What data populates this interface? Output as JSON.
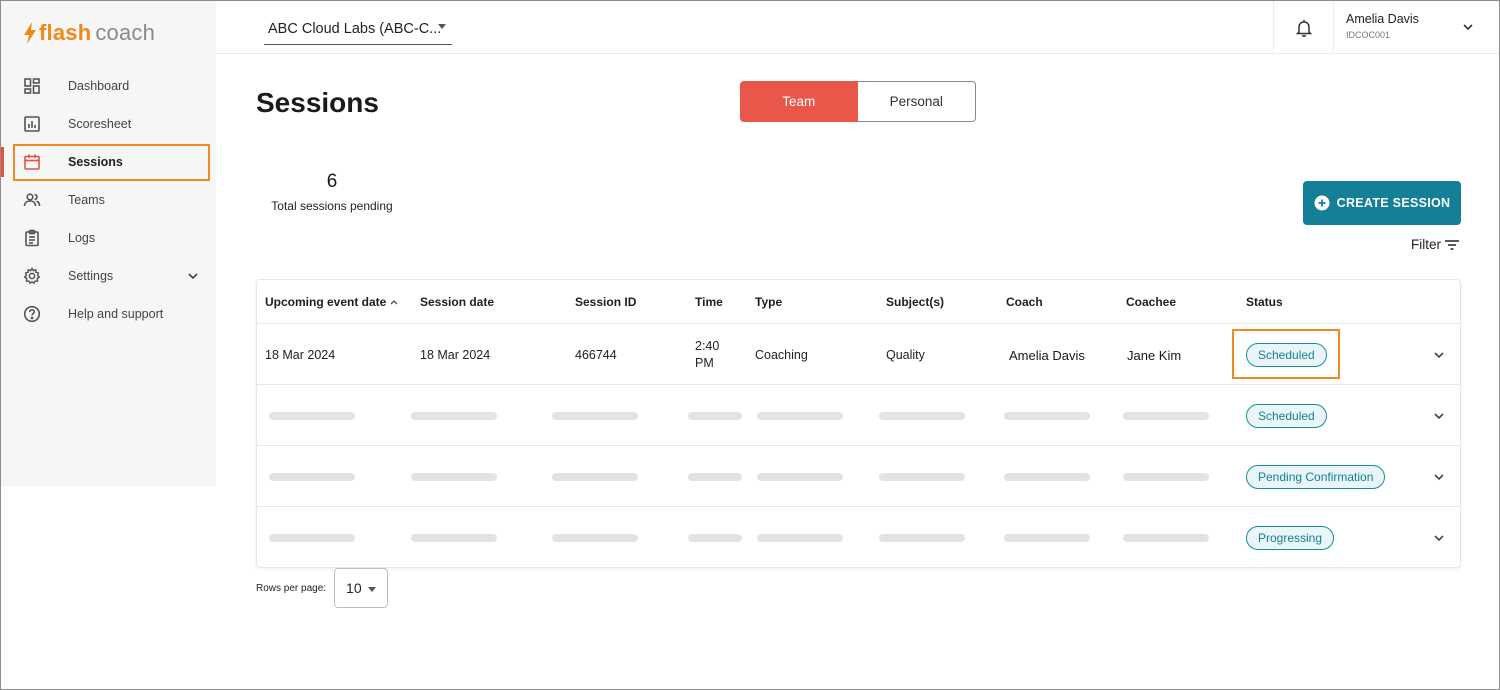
{
  "brand": {
    "part1": "flash",
    "part2": "coach",
    "accent": "#ef8a1a"
  },
  "sidebar": {
    "items": [
      {
        "label": "Dashboard",
        "icon": "dashboard-icon"
      },
      {
        "label": "Scoresheet",
        "icon": "chart-icon"
      },
      {
        "label": "Sessions",
        "icon": "calendar-icon",
        "active": true
      },
      {
        "label": "Teams",
        "icon": "people-icon"
      },
      {
        "label": "Logs",
        "icon": "clipboard-icon"
      },
      {
        "label": "Settings",
        "icon": "gear-icon"
      },
      {
        "label": "Help and support",
        "icon": "help-icon"
      }
    ]
  },
  "topbar": {
    "org": "ABC Cloud Labs (ABC-C...",
    "user_name": "Amelia Davis",
    "user_id": "IDCOC001"
  },
  "main": {
    "title": "Sessions",
    "toggle": {
      "team": "Team",
      "personal": "Personal"
    },
    "stat": {
      "count": "6",
      "label": "Total sessions pending"
    },
    "create_label": "CREATE SESSION",
    "filter_label": "Filter"
  },
  "table": {
    "columns": [
      "Upcoming event date",
      "Session date",
      "Session ID",
      "Time",
      "Type",
      "Subject(s)",
      "Coach",
      "Coachee",
      "Status"
    ],
    "rows": [
      {
        "event_date": "18 Mar 2024",
        "session_date": "18 Mar 2024",
        "session_id": "466744",
        "time_line1": "2:40",
        "time_line2": "PM",
        "type": "Coaching",
        "subject": "Quality",
        "coach": "Amelia Davis",
        "coachee": "Jane Kim",
        "status": "Scheduled"
      },
      {
        "status": "Scheduled"
      },
      {
        "status": "Pending Confirmation"
      },
      {
        "status": "Progressing"
      }
    ]
  },
  "pagination": {
    "rows_per_page_label": "Rows per page:",
    "rows_per_page": "10"
  },
  "colors": {
    "primary_teal": "#147f96",
    "toggle_red": "#e8574a",
    "highlight_orange": "#f08a24"
  }
}
